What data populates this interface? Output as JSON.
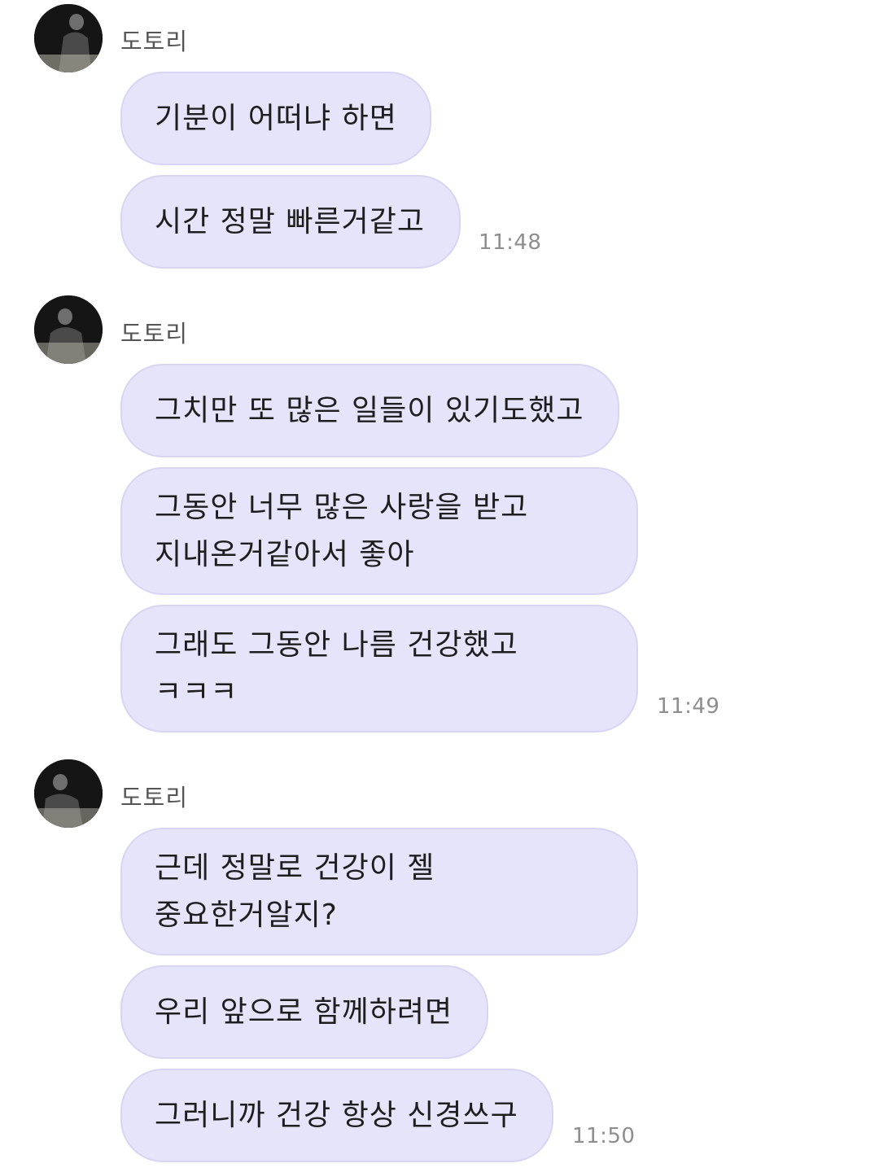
{
  "groups": [
    {
      "sender": "도토리",
      "avatar_icon": "profile-photo",
      "messages": [
        {
          "lines": [
            "기분이 어떠냐 하면"
          ]
        },
        {
          "lines": [
            "시간 정말 빠른거같고"
          ]
        }
      ],
      "time": "11:48"
    },
    {
      "sender": "도토리",
      "avatar_icon": "profile-photo",
      "messages": [
        {
          "lines": [
            "그치만 또 많은 일들이 있기도했고"
          ]
        },
        {
          "lines": [
            "그동안 너무 많은 사랑을 받고",
            "지내온거같아서 좋아"
          ]
        },
        {
          "lines": [
            "그래도 그동안 나름 건강했고",
            "ㅋㅋㅋ"
          ]
        }
      ],
      "time": "11:49"
    },
    {
      "sender": "도토리",
      "avatar_icon": "profile-photo",
      "messages": [
        {
          "lines": [
            "근데 정말로 건강이 젤",
            "중요한거알지?"
          ]
        },
        {
          "lines": [
            "우리 앞으로 함께하려면"
          ]
        },
        {
          "lines": [
            "그러니까 건강 항상 신경쓰구"
          ]
        }
      ],
      "time": "11:50"
    }
  ],
  "colors": {
    "bubble": "#e6e4fb",
    "bubble_border": "#d8d5f3",
    "text": "#1e1e1e",
    "sender": "#555555",
    "time": "#8e8e8e"
  }
}
